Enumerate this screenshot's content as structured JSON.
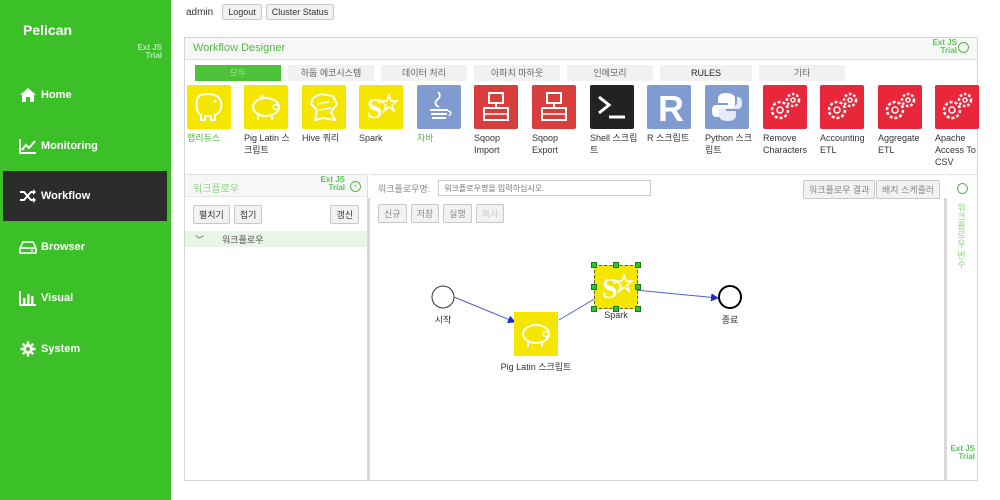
{
  "app": {
    "title": "Pelican",
    "trial_badge": "Ext JS Trial"
  },
  "nav": [
    {
      "label": "Home",
      "icon": "home-icon"
    },
    {
      "label": "Monitoring",
      "icon": "line-chart-icon"
    },
    {
      "label": "Workflow",
      "icon": "shuffle-icon",
      "active": true
    },
    {
      "label": "Browser",
      "icon": "hard-drive-icon"
    },
    {
      "label": "Visual",
      "icon": "bar-chart-icon"
    },
    {
      "label": "System",
      "icon": "gear-icon"
    }
  ],
  "topbar": {
    "user": "admin",
    "logout": "Logout",
    "cluster_status": "Cluster Status"
  },
  "designer": {
    "title": "Workflow Designer",
    "tabs": [
      "모두",
      "하둡 에코시스템",
      "데이터 처리",
      "아파치 마하웃",
      "인메모리",
      "RULES",
      "기타"
    ],
    "palette": [
      {
        "label": "맵리듀스",
        "icon": "hadoop-elephant-icon",
        "color": "#f5e600"
      },
      {
        "label": "Pig Latin 스크립트",
        "icon": "pig-icon",
        "color": "#f5e600"
      },
      {
        "label": "Hive 쿼리",
        "icon": "hive-bee-icon",
        "color": "#f5e600"
      },
      {
        "label": "Spark",
        "icon": "spark-star-icon",
        "color": "#f5e600"
      },
      {
        "label": "자바",
        "icon": "java-cup-icon",
        "color": "#7f9bcf"
      },
      {
        "label": "Sqoop Import",
        "icon": "sqoop-import-icon",
        "color": "#d93d3d"
      },
      {
        "label": "Sqoop Export",
        "icon": "sqoop-export-icon",
        "color": "#d93d3d"
      },
      {
        "label": "Shell 스크립트",
        "icon": "terminal-icon",
        "color": "#222222"
      },
      {
        "label": "R 스크립트",
        "icon": "r-language-icon",
        "color": "#7f9bcf"
      },
      {
        "label": "Python 스크립트",
        "icon": "python-icon",
        "color": "#7f9bcf"
      },
      {
        "label": "Remove Characters",
        "icon": "gears-icon",
        "color": "#e8283a"
      },
      {
        "label": "Accounting ETL",
        "icon": "gears-icon",
        "color": "#e8283a"
      },
      {
        "label": "Aggregate ETL",
        "icon": "gears-icon",
        "color": "#e8283a"
      },
      {
        "label": "Apache Access To CSV",
        "icon": "gears-icon",
        "color": "#e8283a"
      }
    ]
  },
  "left_panel": {
    "title": "워크플로우",
    "expand": "펼치기",
    "collapse": "접기",
    "refresh": "갱신",
    "tree_root": "워크플로우"
  },
  "center_panel": {
    "name_label": "워크플로우명:",
    "name_placeholder": "워크플로우명을 입력하십시오.",
    "result_button": "워크플로우 결과",
    "scheduler_button": "배치 스케줄러",
    "new": "신규",
    "save": "저장",
    "run": "실행",
    "copy": "복사"
  },
  "workflow": {
    "start": "시작",
    "pig": "Pig Latin 스크립트",
    "spark": "Spark",
    "end": "종료"
  },
  "right_panel": {
    "title": "워크플로우 변수"
  }
}
